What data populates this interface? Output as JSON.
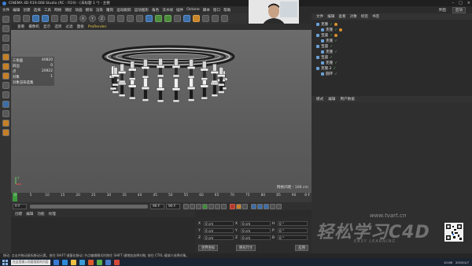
{
  "window": {
    "title": "CINEMA 4D R19.068 Studio (RC - R19) - [未标题 1 *] - 主要"
  },
  "menubar": {
    "items": [
      "文件",
      "编辑",
      "创建",
      "选择",
      "工具",
      "网格",
      "捕捉",
      "动画",
      "模拟",
      "渲染",
      "雕刻",
      "运动跟踪",
      "运动图形",
      "角色",
      "流水线",
      "插件",
      "Octane",
      "脚本",
      "窗口",
      "帮助"
    ]
  },
  "viewport_menu": {
    "items": [
      "查看",
      "摄像机",
      "显示",
      "选项",
      "过滤",
      "面板",
      "ProRender"
    ]
  },
  "stats": {
    "rows": [
      {
        "label": "三角面",
        "value": "40820"
      },
      {
        "label": "四边",
        "value": "0"
      },
      {
        "label": "点",
        "value": "20922"
      },
      {
        "label": "对象",
        "value": "1"
      },
      {
        "label": "对象渲染选集",
        "value": ""
      }
    ]
  },
  "viewport": {
    "grid_label": "网格间距 : 100 cm",
    "axis_label": "Y"
  },
  "timeline": {
    "ticks": [
      "0",
      "5",
      "10",
      "15",
      "20",
      "25",
      "30",
      "35",
      "40",
      "45",
      "50",
      "55",
      "60",
      "65",
      "70",
      "75",
      "80",
      "85",
      "90"
    ],
    "end_label": "0 F"
  },
  "transport": {
    "current_frame": "0 F",
    "start_frame": "0 F",
    "end_frame": "90 F",
    "end_frame2": "90 F"
  },
  "material_menu": {
    "items": [
      "创建",
      "编辑",
      "功能",
      "纹理"
    ]
  },
  "coords": {
    "rows": [
      {
        "a_label": "X",
        "a_val": "0 cm",
        "b_label": "X",
        "b_val": "0 cm",
        "c_label": "H",
        "c_val": "0 °"
      },
      {
        "a_label": "Y",
        "a_val": "0 cm",
        "b_label": "Y",
        "b_val": "0 cm",
        "c_label": "P",
        "c_val": "0 °"
      },
      {
        "a_label": "Z",
        "a_val": "0 cm",
        "b_label": "Z",
        "b_val": "0 cm",
        "c_label": "B",
        "c_val": "0 °"
      }
    ],
    "mode_button": "世界坐标",
    "scale_button": "绝对尺寸",
    "apply_button": "应用"
  },
  "right_top": {
    "layout_label": "界面",
    "layout_value": "启动"
  },
  "object_menu": {
    "items": [
      "文件",
      "编辑",
      "查看",
      "对象",
      "标签",
      "书签"
    ]
  },
  "objects": [
    {
      "name": "克隆"
    },
    {
      "name": "克隆"
    },
    {
      "name": "宝座"
    },
    {
      "name": "克隆"
    },
    {
      "name": "宝座"
    },
    {
      "name": "克隆"
    },
    {
      "name": "宝座"
    },
    {
      "name": "克隆"
    },
    {
      "name": "克隆.2"
    },
    {
      "name": "圆环"
    }
  ],
  "attr_menu": {
    "items": [
      "模式",
      "编辑",
      "用户数据"
    ]
  },
  "watermark": {
    "brand": "轻松学习C4D",
    "url": "www.tvart.cn",
    "sub": "EASY LEARNING"
  },
  "statusbar": {
    "text": "移动: 点击并拖动鼠标移动元素。按住 SHIFT 键量化移动; 节点编辑模式时按住 SHIFT 键增加选择对象; 按住 CTRL 键减少选择对象。"
  },
  "taskbar": {
    "search_placeholder": "在这里输入你要搜索的内容",
    "time": "10:08",
    "date": "2019/1/7"
  },
  "colors": {
    "accent_orange": "#c8862b",
    "accent_blue": "#3c6fa8",
    "accent_green": "#3c9a3c"
  }
}
